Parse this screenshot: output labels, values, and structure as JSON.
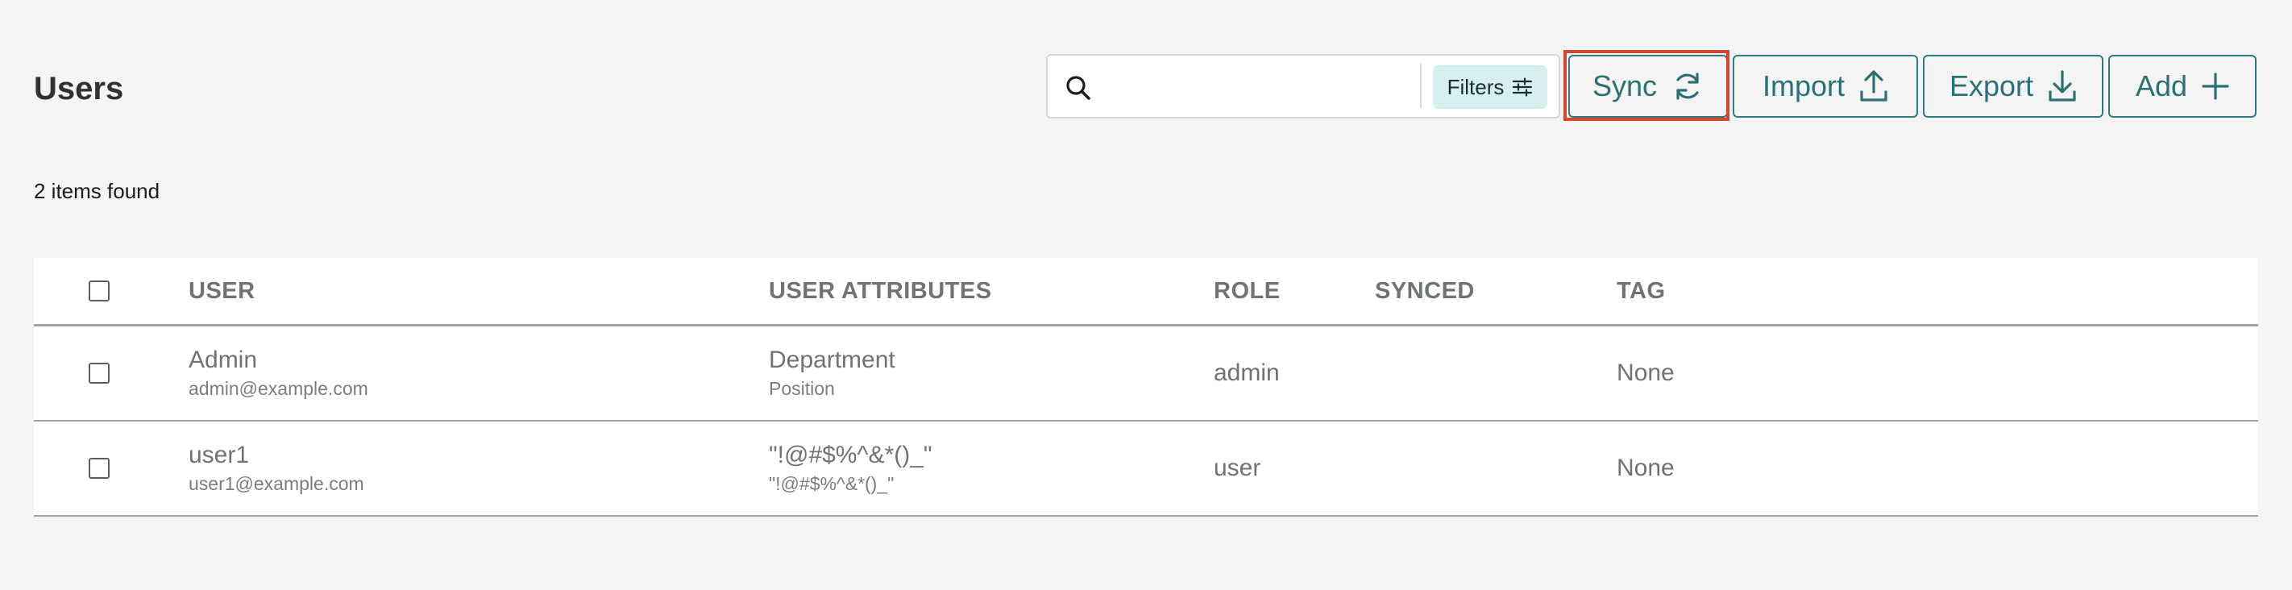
{
  "page": {
    "title": "Users"
  },
  "search": {
    "value": "",
    "placeholder": ""
  },
  "toolbar": {
    "filters_label": "Filters",
    "sync_label": "Sync",
    "import_label": "Import",
    "export_label": "Export",
    "add_label": "Add"
  },
  "results": {
    "count_text": "2 items found"
  },
  "table": {
    "columns": [
      "USER",
      "USER ATTRIBUTES",
      "ROLE",
      "SYNCED",
      "TAG"
    ],
    "rows": [
      {
        "user_name": "Admin",
        "user_email": "admin@example.com",
        "attr_primary": "Department",
        "attr_secondary": "Position",
        "role": "admin",
        "synced": "",
        "tag": "None"
      },
      {
        "user_name": "user1",
        "user_email": "user1@example.com",
        "attr_primary": "\"!@#$%^&*()_\"",
        "attr_secondary": "\"!@#$%^&*()_\"",
        "role": "user",
        "synced": "",
        "tag": "None"
      }
    ]
  },
  "colors": {
    "accent": "#2a7176",
    "highlight": "#d6452e",
    "filters_bg": "#d6efef",
    "page_bg": "#f3f4f3"
  },
  "icons": {
    "search": "search-icon",
    "filters": "sliders-icon",
    "sync": "sync-icon",
    "import": "upload-icon",
    "export": "download-icon",
    "add": "plus-icon"
  }
}
